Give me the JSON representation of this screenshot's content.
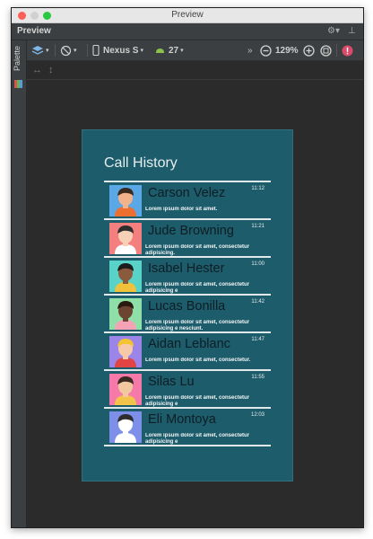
{
  "window": {
    "title": "Preview"
  },
  "panel": {
    "title": "Preview",
    "side_tab": "Palette"
  },
  "toolbar": {
    "device": "Nexus S",
    "api": "27",
    "zoom": "129%",
    "overflow": "»"
  },
  "app": {
    "title": "Call History",
    "calls": [
      {
        "name": "Carson Velez",
        "time": "11:12",
        "desc": "Lorem ipsum dolor sit amet.",
        "bg": "#5aa9e6",
        "skin": "#f2b28a",
        "hair": "#3b2a20",
        "shirt": "#ec6f2f"
      },
      {
        "name": "Jude Browning",
        "time": "11:21",
        "desc": "Lorem ipsum dolor sit amet, consectetur adipisicing.",
        "bg": "#f47f7f",
        "skin": "#f6d1b5",
        "hair": "#2d2d2d",
        "shirt": "#ffffff"
      },
      {
        "name": "Isabel Hester",
        "time": "11:00",
        "desc": "Lorem ipsum dolor sit amet, consectetur adipisicing e",
        "bg": "#59d3c8",
        "skin": "#8b5a3c",
        "hair": "#1d1d1d",
        "shirt": "#f0c23c"
      },
      {
        "name": "Lucas Bonilla",
        "time": "11:42",
        "desc": "Lorem ipsum dolor sit amet, consectetur adipisicing e nesciunt.",
        "bg": "#8ee0a8",
        "skin": "#6b4532",
        "hair": "#2b1a12",
        "shirt": "#f3a3b5"
      },
      {
        "name": "Aidan Leblanc",
        "time": "11:47",
        "desc": "Lorem ipsum dolor sit amet, consectetur.",
        "bg": "#9b85e8",
        "skin": "#f6c9a8",
        "hair": "#f3c331",
        "shirt": "#e04444"
      },
      {
        "name": "Silas Lu",
        "time": "11:55",
        "desc": "Lorem ipsum dolor sit amet, consectetur adipisicing e",
        "bg": "#f57aa9",
        "skin": "#f1c8a0",
        "hair": "#3a2a22",
        "shirt": "#f2c54a"
      },
      {
        "name": "Eli Montoya",
        "time": "12:03",
        "desc": "Lorem ipsum dolor sit amet, consectetur adipisicing e",
        "bg": "#7d8fe8",
        "skin": "#ffffff",
        "hair": "#2d2d2d",
        "shirt": "#ffffff"
      }
    ]
  },
  "colors": {
    "panel_bg": "#2b2b2b",
    "phone_bg": "#1d5c6b",
    "error": "#d94b6a"
  }
}
